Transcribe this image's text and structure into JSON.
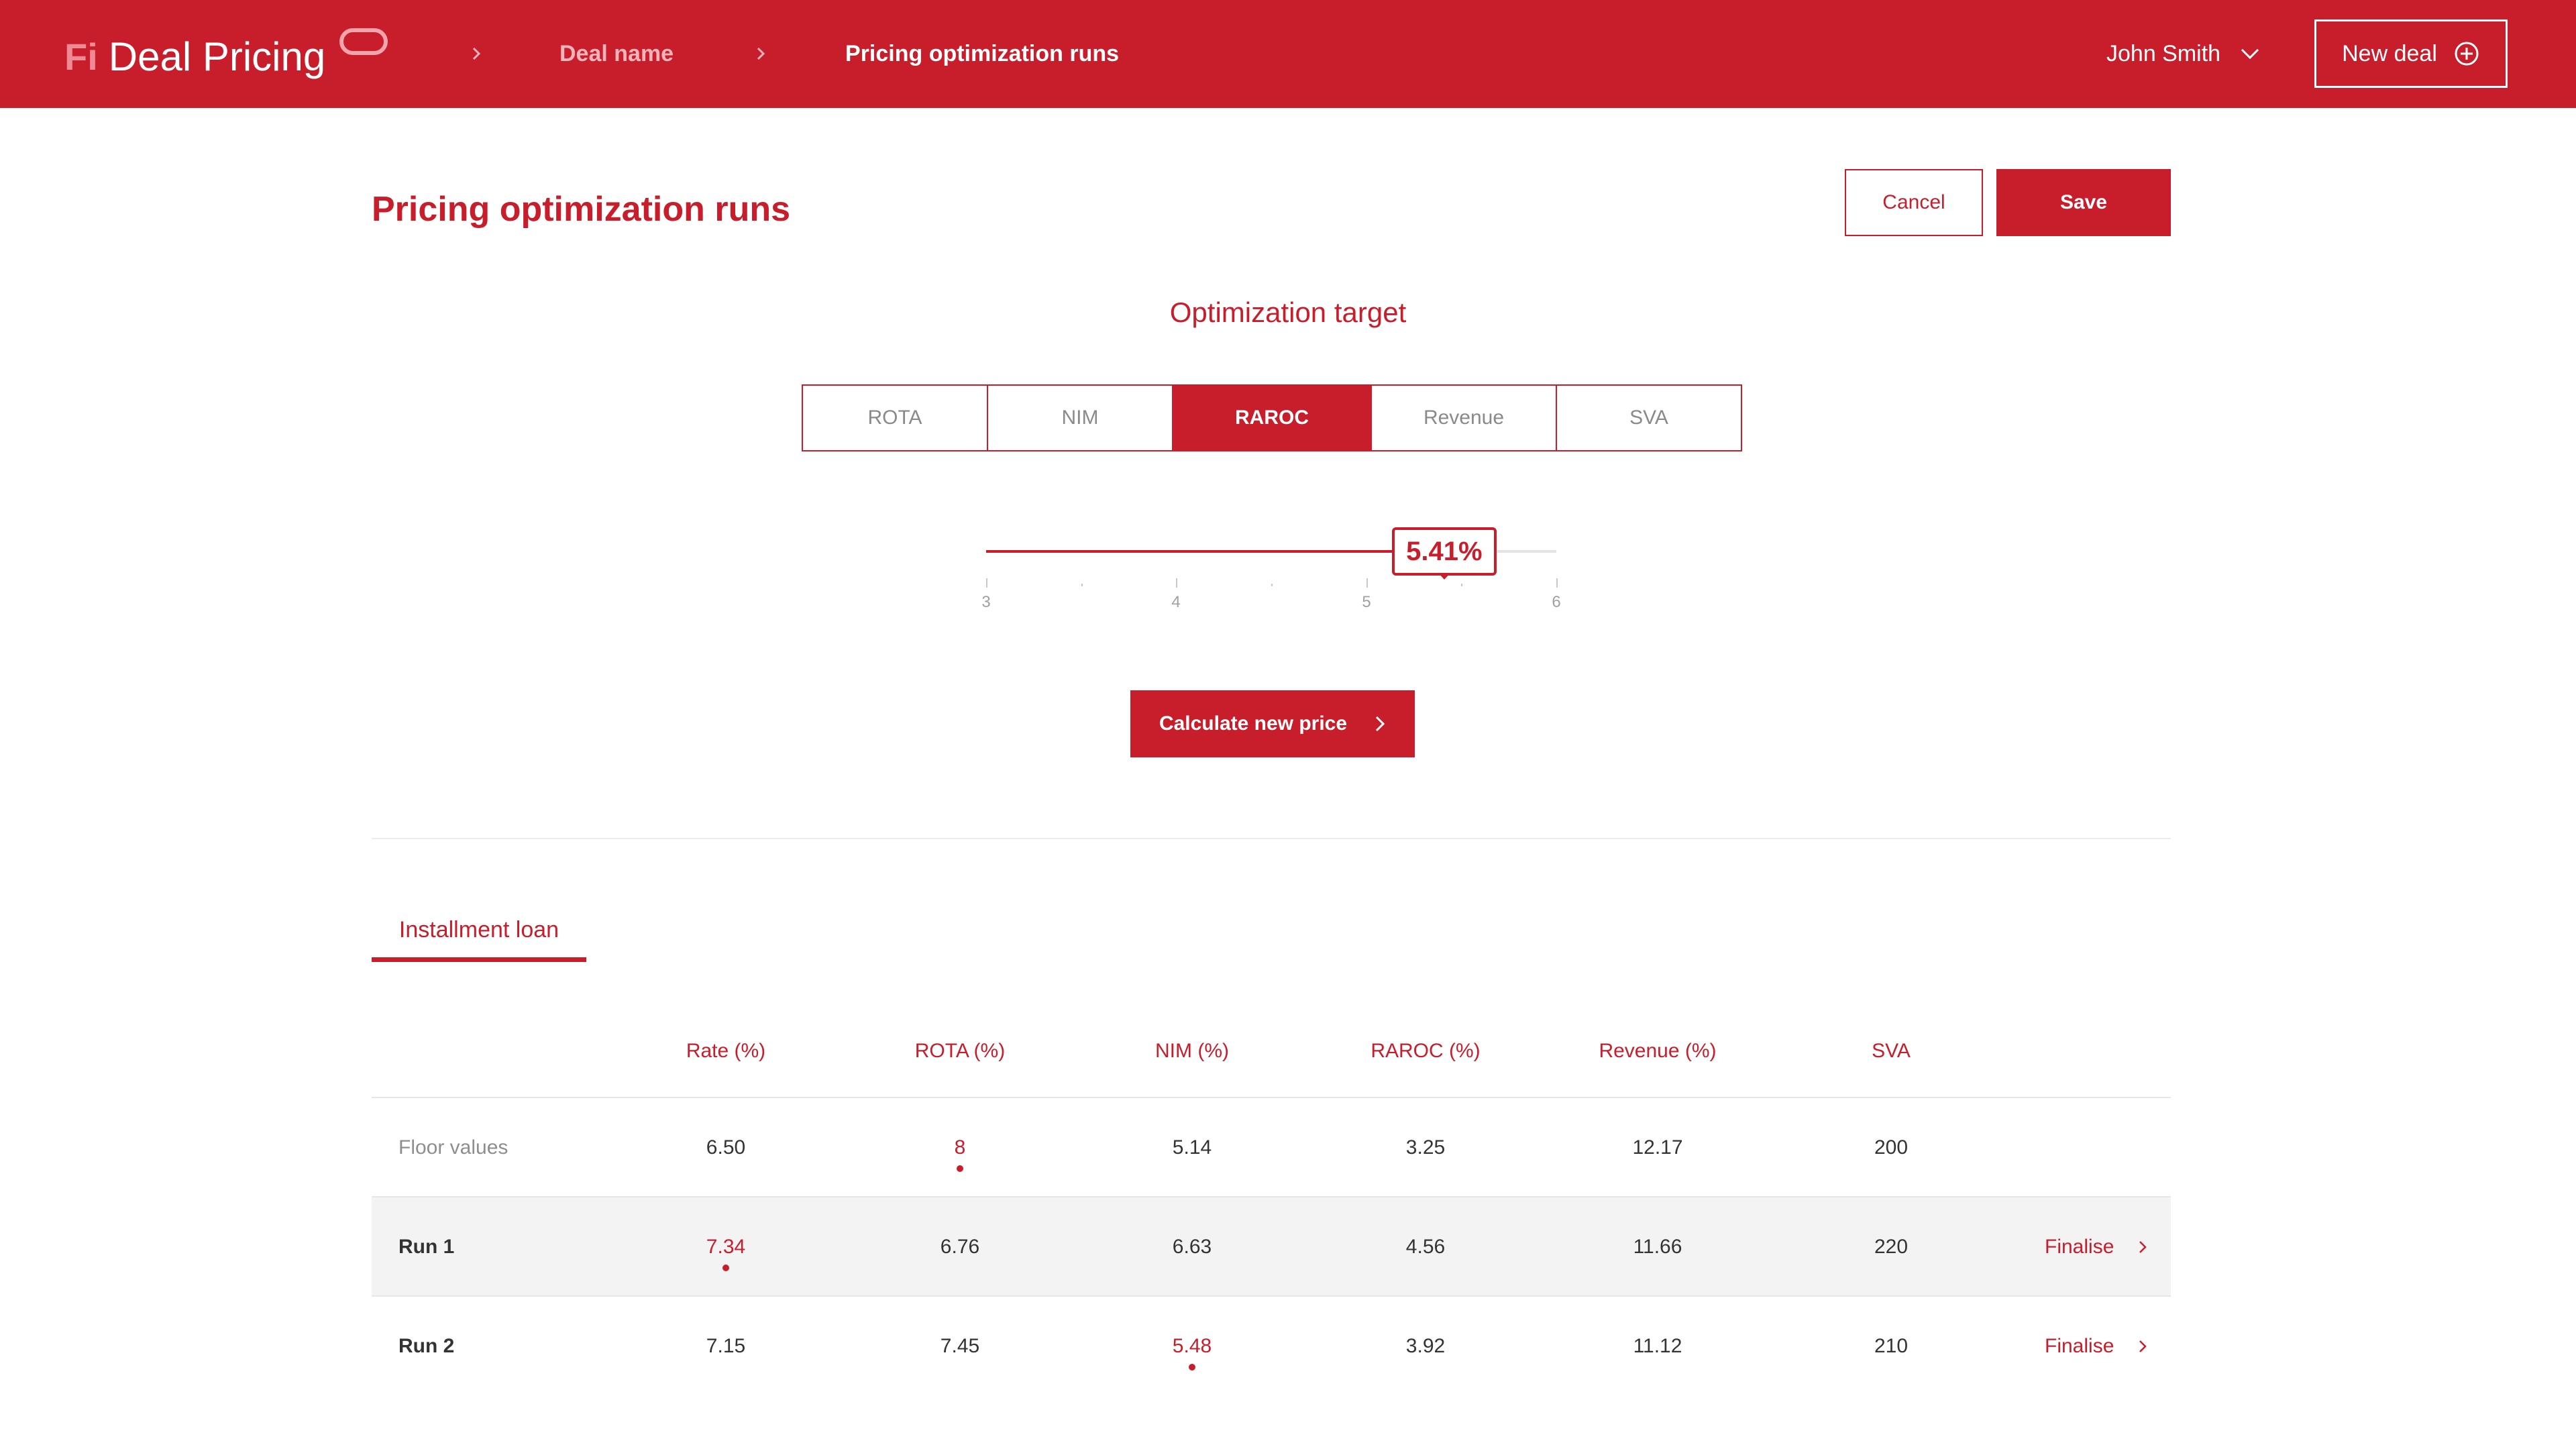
{
  "header": {
    "brand_fi": "Fi",
    "brand_name": "Deal Pricing",
    "breadcrumb": [
      "Deal name",
      "Pricing optimization runs"
    ],
    "user_name": "John Smith",
    "new_deal_label": "New deal",
    "colors": {
      "bar": "#c81d2b",
      "text": "#ffffff"
    }
  },
  "page": {
    "title": "Pricing optimization runs",
    "cancel_label": "Cancel",
    "save_label": "Save"
  },
  "optimization": {
    "title": "Optimization target",
    "options": [
      "ROTA",
      "NIM",
      "RAROC",
      "Revenue",
      "SVA"
    ],
    "selected": "RAROC",
    "slider": {
      "value": 5.41,
      "value_label": "5.41%",
      "min": 3,
      "max": 6,
      "tick_labels": [
        "3",
        "4",
        "5",
        "6"
      ]
    },
    "calculate_label": "Calculate new price"
  },
  "tabs": {
    "active": "Installment loan"
  },
  "table": {
    "columns": [
      "Rate (%)",
      "ROTA (%)",
      "NIM (%)",
      "RAROC (%)",
      "Revenue (%)",
      "SVA"
    ],
    "rows": [
      {
        "label": "Floor values",
        "values": [
          "6.50",
          "8",
          "5.14",
          "3.25",
          "12.17",
          "200"
        ],
        "highlight_index": 1,
        "action": ""
      },
      {
        "label": "Run 1",
        "values": [
          "7.34",
          "6.76",
          "6.63",
          "4.56",
          "11.66",
          "220"
        ],
        "highlight_index": 0,
        "action": "Finalise"
      },
      {
        "label": "Run 2",
        "values": [
          "7.15",
          "7.45",
          "5.48",
          "3.92",
          "11.12",
          "210"
        ],
        "highlight_index": 2,
        "action": "Finalise"
      }
    ]
  },
  "colors": {
    "accent": "#c81d2b",
    "muted_text": "#8e8e8e",
    "row_shade": "#f3f3f3"
  },
  "icons": {
    "breadcrumb_separator": "chevron-right-icon",
    "user_menu": "chevron-down-icon",
    "new_deal": "plus-circle-icon",
    "calculate": "chevron-right-icon",
    "finalise": "chevron-right-icon"
  }
}
